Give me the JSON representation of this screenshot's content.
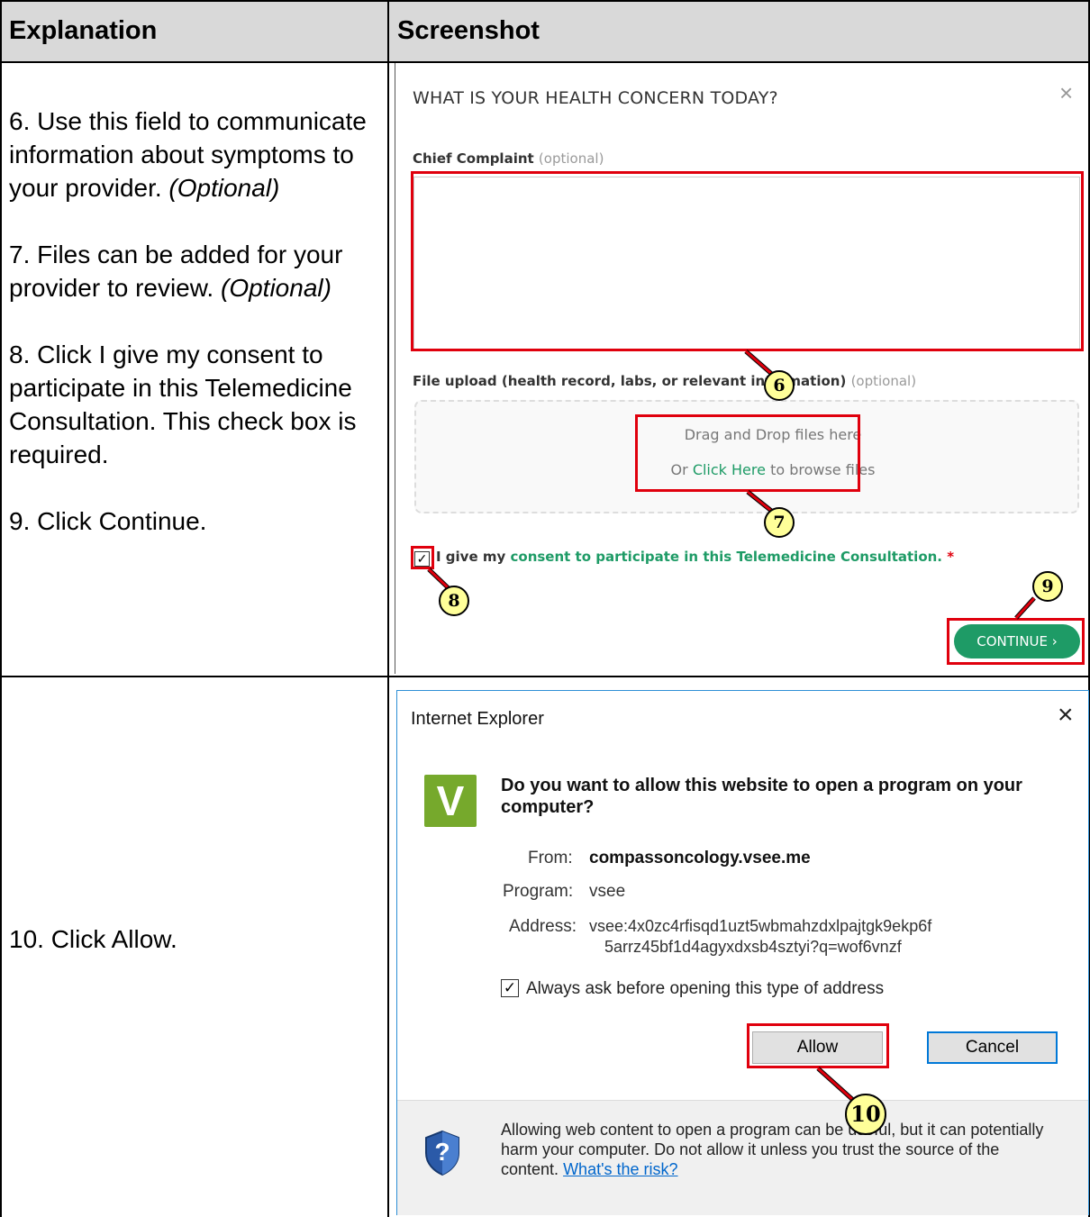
{
  "table": {
    "headers": {
      "explanation": "Explanation",
      "screenshot": "Screenshot"
    },
    "row1": {
      "step6": "6. Use this field to communicate information about symptoms to your provider.",
      "step6_opt": "(Optional)",
      "step7": "7. Files can be added for your provider to review.",
      "step7_opt": "(Optional)",
      "step8": "8. Click I give my consent to participate in this Telemedicine Consultation. This check box is required.",
      "step9": "9. Click Continue."
    },
    "row2": {
      "step10": "10. Click Allow."
    }
  },
  "concern_dialog": {
    "title": "WHAT IS YOUR HEALTH CONCERN TODAY?",
    "close": "×",
    "chief_complaint_label": "Chief Complaint",
    "optional": "(optional)",
    "chief_complaint_value": "",
    "file_upload_label": "File upload (health record, labs, or relevant information)",
    "drag_drop": "Drag and Drop files here",
    "or": "Or",
    "click_here": "Click Here",
    "browse": "to browse files",
    "consent_prefix": "I give my",
    "consent_link": "consent to participate in this Telemedicine Consultation.",
    "required_mark": "*",
    "continue": "CONTINUE ›",
    "consent_checked": true
  },
  "callouts": {
    "c6": "6",
    "c7": "7",
    "c8": "8",
    "c9": "9",
    "c10": "10"
  },
  "ie_dialog": {
    "title": "Internet Explorer",
    "close": "×",
    "app_icon_letter": "V",
    "question": "Do you want to allow this website to open a program on your computer?",
    "from_label": "From:",
    "from_value": "compassoncology.vsee.me",
    "program_label": "Program:",
    "program_value": "vsee",
    "address_label": "Address:",
    "address_line1": "vsee:4x0zc4rfisqd1uzt5wbmahzdxlpajtgk9ekp6f",
    "address_line2": "5arrz45bf1d4agyxdxsb4sztyi?q=wof6vnzf",
    "always_ask": "Always ask before opening this type of address",
    "always_ask_checked": true,
    "allow": "Allow",
    "cancel": "Cancel",
    "warning": "Allowing web content to open a program can be useful, but it can potentially harm your computer. Do not allow it unless you trust the source of the content.",
    "risk_link": "What's the risk?",
    "shield_glyph": "?"
  },
  "colors": {
    "accent_green": "#1e9b66",
    "highlight_red": "#e0000d",
    "callout_yellow": "#ffff99"
  }
}
